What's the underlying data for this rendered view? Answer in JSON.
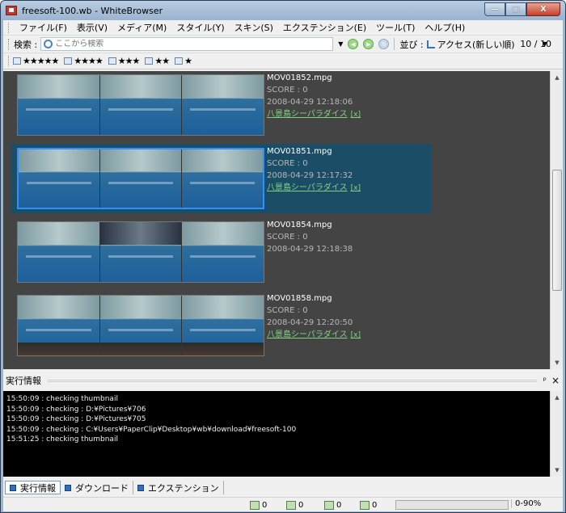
{
  "window": {
    "title": "freesoft-100.wb - WhiteBrowser",
    "buttons": {
      "minimize": "—",
      "maximize": "□",
      "close": "X"
    }
  },
  "menu": [
    "ファイル(F)",
    "表示(V)",
    "メディア(M)",
    "スタイル(Y)",
    "スキン(S)",
    "エクステンション(E)",
    "ツール(T)",
    "ヘルプ(H)"
  ],
  "toolbar": {
    "search_label": "検索 :",
    "search_placeholder": "ここから検索",
    "sort_label": "並び :",
    "sort_value": "アクセス(新しい順)",
    "count": "10 / 10"
  },
  "star_filters": [
    "★★★★★",
    "★★★★",
    "★★★",
    "★★",
    "★"
  ],
  "items": [
    {
      "filename": "MOV01852.mpg",
      "score": "SCORE : 0",
      "date": "2008-04-29 12:18:06",
      "tag": "八景島シーパラダイス",
      "tag_remove": "[x]",
      "selected": false
    },
    {
      "filename": "MOV01851.mpg",
      "score": "SCORE : 0",
      "date": "2008-04-29 12:17:32",
      "tag": "八景島シーパラダイス",
      "tag_remove": "[x]",
      "selected": true
    },
    {
      "filename": "MOV01854.mpg",
      "score": "SCORE : 0",
      "date": "2008-04-29 12:18:38",
      "tag": "",
      "tag_remove": "",
      "selected": false
    },
    {
      "filename": "MOV01858.mpg",
      "score": "SCORE : 0",
      "date": "2008-04-29 12:20:50",
      "tag": "八景島シーパラダイス",
      "tag_remove": "[x]",
      "selected": false
    }
  ],
  "log_panel": {
    "title": "実行情報",
    "pin": "ᵖ",
    "close": "×",
    "lines": [
      "15:50:09 : checking thumbnail",
      "15:50:09 : checking : D:¥Pictures¥706",
      "15:50:09 : checking : D:¥Pictures¥705",
      "15:50:09 : checking : C:¥Users¥PaperClip¥Desktop¥wb¥download¥freesoft-100",
      "15:51:25 : checking thumbnail"
    ]
  },
  "tabs": [
    "実行情報",
    "ダウンロード",
    "エクステンション"
  ],
  "status": {
    "counts": [
      "0",
      "0",
      "0",
      "0"
    ],
    "ratio": "0-90%",
    "progress": 0
  },
  "scrollbar": {
    "up": "▲",
    "down": "▼"
  }
}
